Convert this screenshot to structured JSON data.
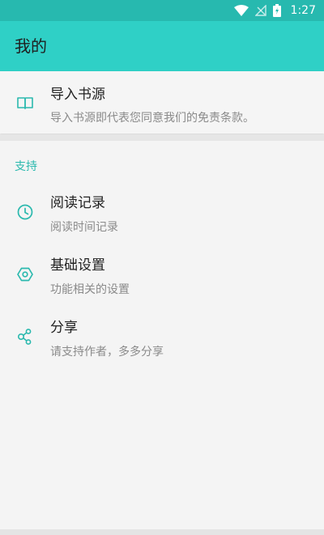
{
  "status": {
    "time": "1:27"
  },
  "app_bar": {
    "title": "我的"
  },
  "import": {
    "title": "导入书源",
    "subtitle": "导入书源即代表您同意我们的免责条款。"
  },
  "section": {
    "header": "支持",
    "items": [
      {
        "title": "阅读记录",
        "subtitle": "阅读时间记录"
      },
      {
        "title": "基础设置",
        "subtitle": "功能相关的设置"
      },
      {
        "title": "分享",
        "subtitle": "请支持作者，多多分享"
      }
    ]
  },
  "colors": {
    "status_bar": "#27b9af",
    "app_bar": "#2fd0c6",
    "accent": "#2bb9ae",
    "background": "#f4f4f4"
  },
  "icons": [
    "wifi-icon",
    "signal-icon",
    "battery-charging-icon",
    "book-icon",
    "clock-icon",
    "gear-icon",
    "share-icon"
  ]
}
